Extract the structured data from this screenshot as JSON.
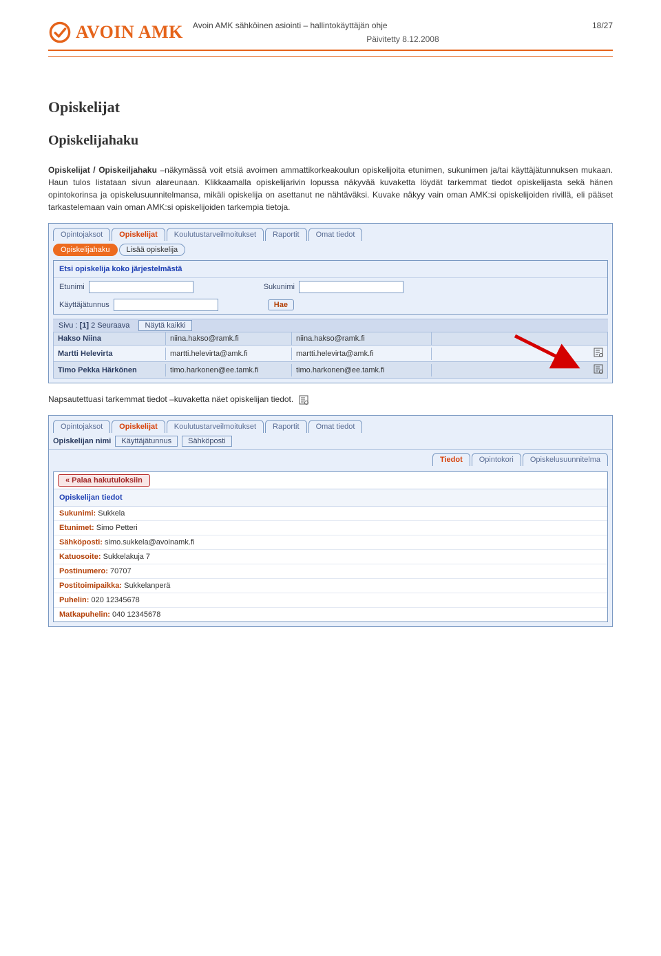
{
  "header": {
    "logo_text": "AVOIN AMK",
    "doc_title": "Avoin AMK sähköinen asiointi – hallintokäyttäjän ohje",
    "page_num": "18/27",
    "date_label": "Päivitetty 8.12.2008"
  },
  "section": {
    "title": "Opiskelijat",
    "subtitle": "Opiskelijahaku"
  },
  "para": {
    "p1_bold": "Opiskelijat / Opiskeiljahaku",
    "p1_rest": " –näkymässä voit etsiä avoimen ammattikorkeakoulun opiskelijoita etunimen, sukunimen ja/tai käyttäjätunnuksen mukaan. Haun tulos listataan sivun alareunaan. Klikkaamalla opiskelijarivin lopussa näkyvää kuvaketta löydät tarkemmat tiedot opiskelijasta sekä hänen opintokorinsa ja opiskelusuunnitelmansa, mikäli opiskelija on asettanut ne nähtäväksi. Kuvake näkyy vain oman AMK:si opiskelijoiden rivillä, eli pääset tarkastelemaan vain oman AMK:si opiskelijoiden tarkempia tietoja.",
    "p2": "Napsautettuasi tarkemmat tiedot –kuvaketta näet opiskelijan tiedot."
  },
  "shot1": {
    "tabs": [
      "Opintojaksot",
      "Opiskelijat",
      "Koulutustarveilmoitukset",
      "Raportit",
      "Omat tiedot"
    ],
    "active_tab": 1,
    "subtabs": [
      "Opiskelijahaku",
      "Lisää opiskelija"
    ],
    "active_sub": 0,
    "search_title": "Etsi opiskelija koko järjestelmästä",
    "labels": {
      "etunimi": "Etunimi",
      "sukunimi": "Sukunimi",
      "kayttaja": "Käyttäjätunnus",
      "hae": "Hae"
    },
    "pager": {
      "prefix": "Sivu :",
      "current": "[1]",
      "p2": "2",
      "next": "Seuraava",
      "showall": "Näytä kaikki"
    },
    "rows": [
      {
        "name": "Hakso Niina",
        "m1": "niina.hakso@ramk.fi",
        "m2": "niina.hakso@ramk.fi",
        "icon": false
      },
      {
        "name": "Martti Helevirta",
        "m1": "martti.helevirta@amk.fi",
        "m2": "martti.helevirta@amk.fi",
        "icon": true
      },
      {
        "name": "Timo Pekka Härkönen",
        "m1": "timo.harkonen@ee.tamk.fi",
        "m2": "timo.harkonen@ee.tamk.fi",
        "icon": true
      }
    ]
  },
  "shot2": {
    "tabs": [
      "Opintojaksot",
      "Opiskelijat",
      "Koulutustarveilmoitukset",
      "Raportit",
      "Omat tiedot"
    ],
    "active_tab": 1,
    "toolbar": {
      "label": "Opiskelijan nimi",
      "btn1": "Käyttäjätunnus",
      "btn2": "Sähköposti"
    },
    "tabs2": [
      "Tiedot",
      "Opintokori",
      "Opiskelusuunnitelma"
    ],
    "active_tab2": 0,
    "back": "« Palaa hakutuloksiin",
    "detail_title": "Opiskelijan tiedot",
    "fields": [
      {
        "k": "Sukunimi:",
        "v": "Sukkela"
      },
      {
        "k": "Etunimet:",
        "v": "Simo Petteri"
      },
      {
        "k": "Sähköposti:",
        "v": "simo.sukkela@avoinamk.fi"
      },
      {
        "k": "Katuosoite:",
        "v": "Sukkelakuja 7"
      },
      {
        "k": "Postinumero:",
        "v": "70707"
      },
      {
        "k": "Postitoimipaikka:",
        "v": "Sukkelanperä"
      },
      {
        "k": "Puhelin:",
        "v": "020 12345678"
      },
      {
        "k": "Matkapuhelin:",
        "v": "040 12345678"
      }
    ]
  }
}
